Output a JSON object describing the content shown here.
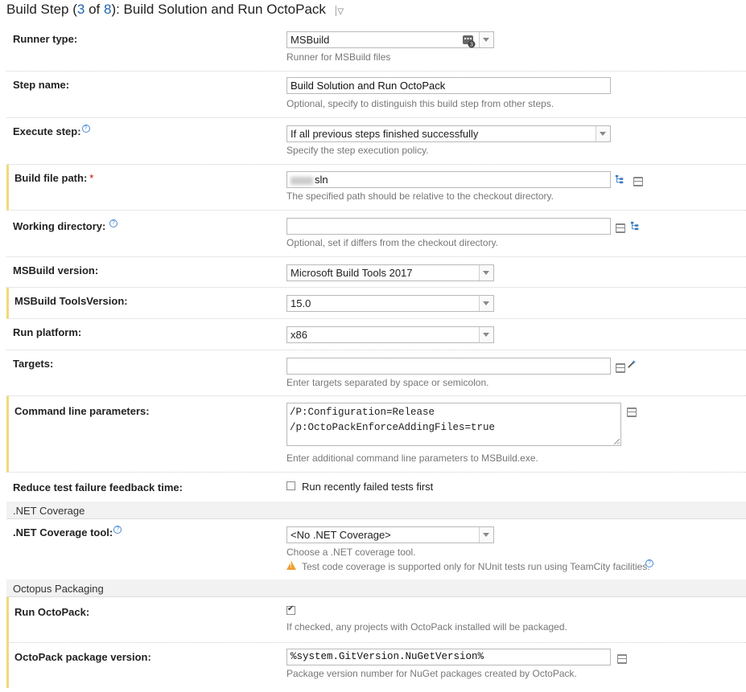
{
  "header": {
    "prefix": "Build Step (",
    "current": "3",
    "of": " of ",
    "total": "8",
    "suffix": "): Build Solution and Run OctoPack"
  },
  "fields": {
    "runner_type": {
      "label": "Runner type:",
      "value": "MSBuild",
      "note": "Runner for MSBuild files",
      "badge": "3"
    },
    "step_name": {
      "label": "Step name:",
      "value": "Build Solution and Run OctoPack",
      "note": "Optional, specify to distinguish this build step from other steps."
    },
    "execute_step": {
      "label": "Execute step:",
      "value": "If all previous steps finished successfully",
      "note": "Specify the step execution policy."
    },
    "build_file_path": {
      "label": "Build file path:",
      "required_mark": "*",
      "value": "sln",
      "note": "The specified path should be relative to the checkout directory."
    },
    "working_directory": {
      "label": "Working directory:",
      "value": "",
      "note": "Optional, set if differs from the checkout directory."
    },
    "msbuild_version": {
      "label": "MSBuild version:",
      "value": "Microsoft Build Tools 2017"
    },
    "msbuild_toolsversion": {
      "label": "MSBuild ToolsVersion:",
      "value": "15.0"
    },
    "run_platform": {
      "label": "Run platform:",
      "value": "x86"
    },
    "targets": {
      "label": "Targets:",
      "value": "",
      "note": "Enter targets separated by space or semicolon."
    },
    "command_line": {
      "label": "Command line parameters:",
      "line1": "/P:Configuration=Release",
      "line2": "/p:OctoPackEnforceAddingFiles=true",
      "note": "Enter additional command line parameters to MSBuild.exe."
    },
    "reduce_test": {
      "label": "Reduce test failure feedback time:",
      "checkbox_label": "Run recently failed tests first",
      "checked": false
    }
  },
  "net_coverage": {
    "section_title": ".NET Coverage",
    "tool_label": ".NET Coverage tool:",
    "tool_value": "<No .NET Coverage>",
    "note": "Choose a .NET coverage tool.",
    "warning": "Test code coverage is supported only for NUnit tests run using TeamCity facilities."
  },
  "octopus": {
    "section_title": "Octopus Packaging",
    "run_label": "Run OctoPack:",
    "run_checked": true,
    "run_note": "If checked, any projects with OctoPack installed will be packaged.",
    "version_label": "OctoPack package version:",
    "version_value": "%system.GitVersion.NuGetVersion%",
    "version_note": "Package version number for NuGet packages created by OctoPack."
  },
  "icons": {
    "help": "help-circle-icon",
    "tree": "tree-browse-icon",
    "list": "parameter-list-icon",
    "wand": "magic-wand-icon",
    "warning": "warning-triangle-icon",
    "runner": "runner-badge-icon"
  },
  "colors": {
    "highlight": "#f2d87a",
    "link": "#1f63b3",
    "required": "#cc0000",
    "warning": "#f0a030"
  }
}
